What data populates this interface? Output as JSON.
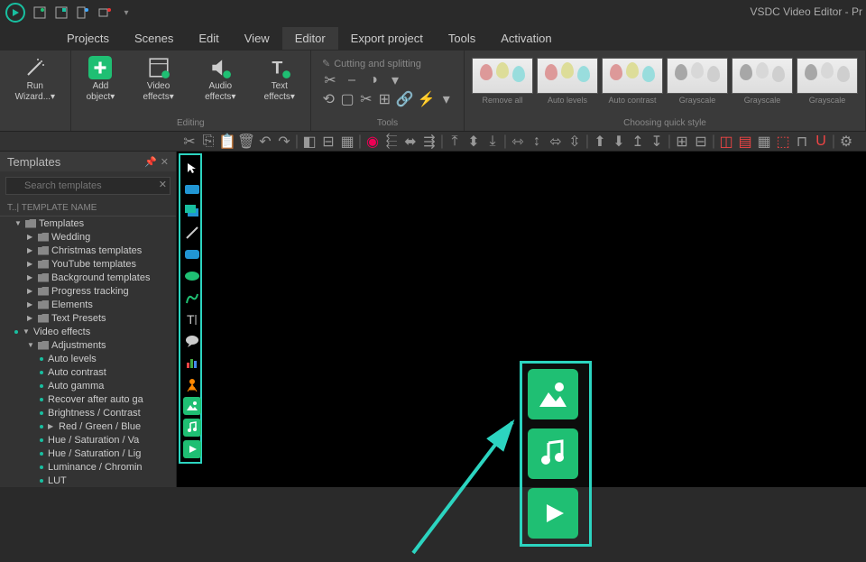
{
  "app_title": "VSDC Video Editor - Pr",
  "menus": [
    "Projects",
    "Scenes",
    "Edit",
    "View",
    "Editor",
    "Export project",
    "Tools",
    "Activation"
  ],
  "active_menu": 4,
  "ribbon": {
    "wizard": {
      "label": "Run\nWizard...▾",
      "icon": "wand"
    },
    "editing": {
      "label": "Editing",
      "items": [
        {
          "label": "Add\nobject▾",
          "icon": "plus",
          "color": "#1fbf73"
        },
        {
          "label": "Video\neffects▾",
          "icon": "film"
        },
        {
          "label": "Audio\neffects▾",
          "icon": "speaker"
        },
        {
          "label": "Text\neffects▾",
          "icon": "text"
        }
      ]
    },
    "tools": {
      "label": "Tools",
      "cutting": "Cutting and splitting"
    },
    "styles": {
      "label": "Choosing quick style",
      "items": [
        "Remove all",
        "Auto levels",
        "Auto contrast",
        "Grayscale",
        "Grayscale",
        "Grayscale"
      ]
    }
  },
  "templates_panel": {
    "title": "Templates",
    "search_placeholder": "Search templates",
    "header": "T..| TEMPLATE NAME",
    "tree": [
      {
        "l": "Templates",
        "d": 1,
        "a": "▼",
        "f": 1
      },
      {
        "l": "Wedding",
        "d": 2,
        "a": "▶",
        "f": 1
      },
      {
        "l": "Christmas templates",
        "d": 2,
        "a": "▶",
        "f": 1
      },
      {
        "l": "YouTube templates",
        "d": 2,
        "a": "▶",
        "f": 1
      },
      {
        "l": "Background templates",
        "d": 2,
        "a": "▶",
        "f": 1
      },
      {
        "l": "Progress tracking",
        "d": 2,
        "a": "▶",
        "f": 1
      },
      {
        "l": "Elements",
        "d": 2,
        "a": "▶",
        "f": 1
      },
      {
        "l": "Text Presets",
        "d": 2,
        "a": "▶",
        "f": 1
      },
      {
        "l": "Video effects",
        "d": 1,
        "a": "▼",
        "b": 1
      },
      {
        "l": "Adjustments",
        "d": 2,
        "a": "▼",
        "f": 1
      },
      {
        "l": "Auto levels",
        "d": 3,
        "b": 1
      },
      {
        "l": "Auto contrast",
        "d": 3,
        "b": 1
      },
      {
        "l": "Auto gamma",
        "d": 3,
        "b": 1
      },
      {
        "l": "Recover after auto ga",
        "d": 3,
        "b": 1
      },
      {
        "l": "Brightness / Contrast",
        "d": 3,
        "b": 1
      },
      {
        "l": "Red / Green / Blue",
        "d": 3,
        "a": "▶",
        "b": 1
      },
      {
        "l": "Hue / Saturation / Va",
        "d": 3,
        "b": 1
      },
      {
        "l": "Hue / Saturation / Lig",
        "d": 3,
        "b": 1
      },
      {
        "l": "Luminance / Chromin",
        "d": 3,
        "b": 1
      },
      {
        "l": "LUT",
        "d": 3,
        "b": 1
      }
    ]
  }
}
